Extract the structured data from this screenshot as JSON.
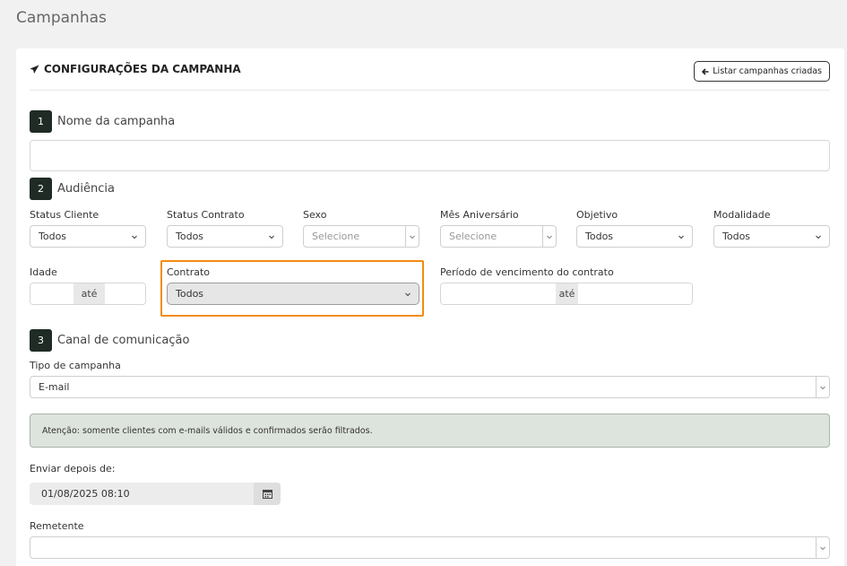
{
  "page": {
    "title": "Campanhas"
  },
  "header": {
    "title": "CONFIGURAÇÕES DA CAMPANHA",
    "list_button": "Listar campanhas criadas"
  },
  "steps": [
    {
      "number": "1",
      "label": "Nome da campanha"
    },
    {
      "number": "2",
      "label": "Audiência"
    },
    {
      "number": "3",
      "label": "Canal de comunicação"
    }
  ],
  "campaign_name": {
    "value": ""
  },
  "audience": {
    "filters": [
      {
        "label": "Status Cliente",
        "value": "Todos"
      },
      {
        "label": "Status Contrato",
        "value": "Todos"
      },
      {
        "label": "Sexo",
        "value": "Selecione"
      },
      {
        "label": "Mês Aniversário",
        "value": "Selecione"
      },
      {
        "label": "Objetivo",
        "value": "Todos"
      },
      {
        "label": "Modalidade",
        "value": "Todos"
      }
    ],
    "idade": {
      "label": "Idade",
      "separator": "até"
    },
    "contrato": {
      "label": "Contrato",
      "value": "Todos"
    },
    "periodo": {
      "label": "Período de vencimento do contrato",
      "separator": "até"
    }
  },
  "channel": {
    "tipo_label": "Tipo de campanha",
    "tipo_value": "E-mail",
    "alert": "Atenção: somente clientes com e-mails válidos e confirmados serão filtrados.",
    "enviar_label": "Enviar depois de:",
    "enviar_value": "01/08/2025 08:10",
    "remetente_label": "Remetente",
    "remetente_value": ""
  },
  "colors": {
    "highlight": "#f28c13",
    "step_badge": "#1f2b24",
    "alert_bg": "#dde3dd"
  },
  "icons": {
    "header": "paper-plane-icon",
    "list_button": "arrow-left-icon",
    "date": "calendar-icon",
    "select": "chevron-down-icon"
  }
}
